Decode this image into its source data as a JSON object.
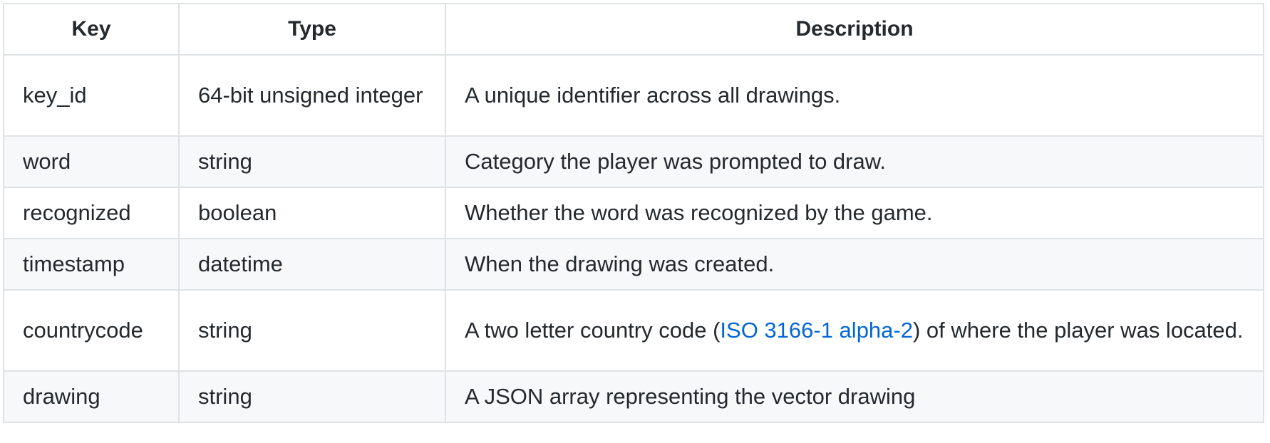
{
  "table": {
    "headers": [
      "Key",
      "Type",
      "Description"
    ],
    "rows": [
      {
        "key": "key_id",
        "type": "64-bit unsigned integer",
        "description": "A unique identifier across all drawings."
      },
      {
        "key": "word",
        "type": "string",
        "description": "Category the player was prompted to draw."
      },
      {
        "key": "recognized",
        "type": "boolean",
        "description": "Whether the word was recognized by the game."
      },
      {
        "key": "timestamp",
        "type": "datetime",
        "description": "When the drawing was created."
      },
      {
        "key": "countrycode",
        "type": "string",
        "description_before": "A two letter country code (",
        "description_link": "ISO 3166-1 alpha-2",
        "description_after": ") of where the player was located."
      },
      {
        "key": "drawing",
        "type": "string",
        "description": "A JSON array representing the vector drawing"
      }
    ]
  },
  "colors": {
    "text": "#24292e",
    "border": "#dfe2e5",
    "stripe": "#f6f8fa",
    "link": "#0366d6"
  }
}
